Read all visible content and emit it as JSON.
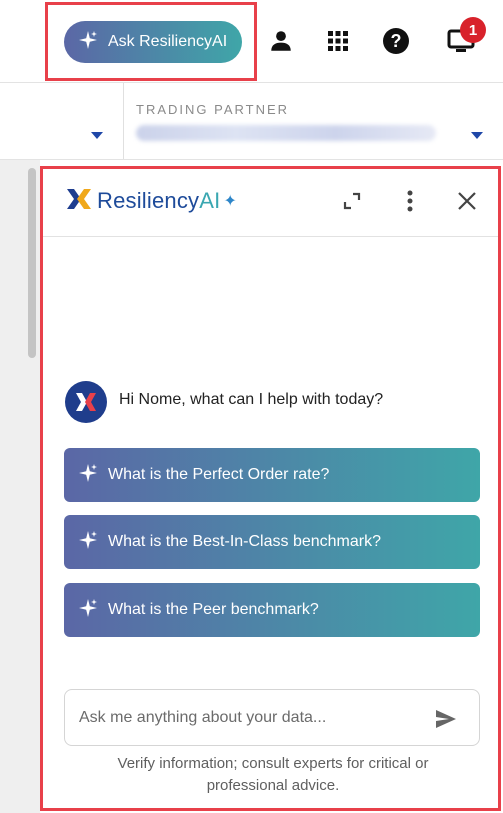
{
  "header": {
    "ask_button_label": "Ask ResiliencyAI",
    "notification_count": "1",
    "colors": {
      "gradient_start": "#5b67a6",
      "gradient_end": "#3fa6a8",
      "highlight": "#e8404a",
      "badge": "#d8222b"
    },
    "icons": [
      "sparkle-icon",
      "user-icon",
      "apps-grid-icon",
      "help-icon",
      "monitor-icon"
    ]
  },
  "filters": {
    "trading_partner_label": "TRADING PARTNER",
    "trading_partner_value": ""
  },
  "chat": {
    "logo_text_main": "Resiliency",
    "logo_text_ai": "AI",
    "logo_spark": "✦",
    "greeting": "Hi Nome, what can I help with today?",
    "suggestions": [
      "What is the Perfect Order rate?",
      "What is the Best-In-Class benchmark?",
      "What is the Peer benchmark?"
    ],
    "input_placeholder": "Ask me anything about your data...",
    "disclaimer": "Verify information; consult experts for critical or professional advice."
  }
}
